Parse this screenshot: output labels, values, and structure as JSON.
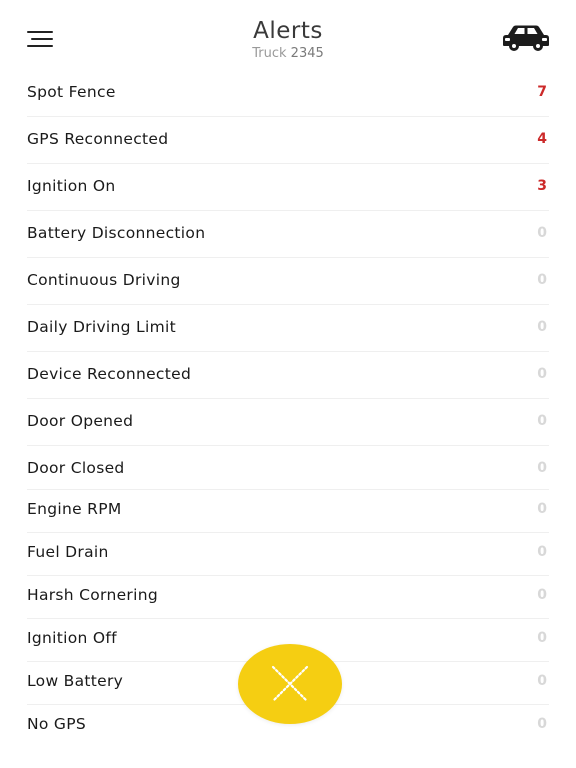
{
  "header": {
    "title": "Alerts",
    "subtitle_prefix": "Truck",
    "subtitle_number": "2345",
    "menu_icon": "hamburger-menu-icon",
    "vehicle_icon": "car-icon"
  },
  "alerts": [
    {
      "label": "Spot Fence",
      "count": "7"
    },
    {
      "label": "GPS Reconnected",
      "count": "4"
    },
    {
      "label": "Ignition On",
      "count": "3"
    },
    {
      "label": "Battery Disconnection",
      "count": "0"
    },
    {
      "label": "Continuous Driving",
      "count": "0"
    },
    {
      "label": "Daily Driving Limit",
      "count": "0"
    },
    {
      "label": "Device Reconnected",
      "count": "0"
    },
    {
      "label": "Door Opened",
      "count": "0"
    },
    {
      "label": "Door Closed",
      "count": "0"
    },
    {
      "label": "Engine RPM",
      "count": "0"
    },
    {
      "label": "Fuel Drain",
      "count": "0"
    },
    {
      "label": "Harsh Cornering",
      "count": "0"
    },
    {
      "label": "Ignition Off",
      "count": "0"
    },
    {
      "label": "Low Battery",
      "count": "0"
    },
    {
      "label": "No GPS",
      "count": "0"
    }
  ],
  "fab": {
    "icon": "close-icon",
    "color": "#f5ce12"
  },
  "colors": {
    "alert_count": "#cc2a2a",
    "zero_count": "#d8d8d8",
    "divider": "#efefef"
  }
}
